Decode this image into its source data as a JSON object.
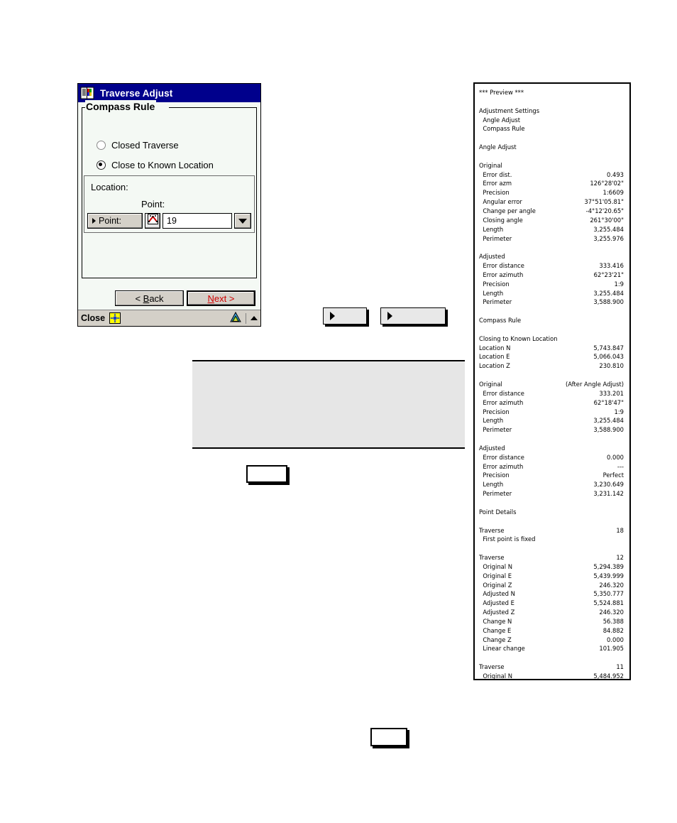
{
  "dialog": {
    "title": "Traverse Adjust",
    "title_icon": "book-icon",
    "group_legend": "Compass Rule",
    "radios": [
      {
        "label": "Closed Traverse",
        "checked": false
      },
      {
        "label": "Close to Known Location",
        "checked": true
      }
    ],
    "location_panel": {
      "location_label": "Location:",
      "point_caption": "Point:",
      "point_button_label": "Point:",
      "map_icon": "point-picker-icon",
      "point_value": "19",
      "dropdown_icon": "chevron-down-icon"
    },
    "buttons": {
      "back": "< Back",
      "back_underline": "B",
      "next": "Next >",
      "next_underline": "N"
    },
    "statusbar": {
      "close_label": "Close",
      "input_panel_icon": "input-panel-icon",
      "alert_icon": "warning-triangle-icon",
      "expand_icon": "chevron-up-icon"
    }
  },
  "arrow_buttons": [
    {
      "name": "arrow-button-1",
      "icon": "triangle-right-icon",
      "label": ""
    },
    {
      "name": "arrow-button-2",
      "icon": "triangle-right-icon",
      "label": ""
    }
  ],
  "gray_panel": {
    "content": ""
  },
  "empty_boxes": [
    {
      "name": "empty-box-1",
      "content": ""
    },
    {
      "name": "empty-box-2",
      "content": ""
    }
  ],
  "preview": {
    "header": "*** Preview ***",
    "lines": [
      {
        "label": "*** Preview ***",
        "value": ""
      },
      {
        "blank": true
      },
      {
        "label": "Adjustment Settings",
        "value": ""
      },
      {
        "label": "  Angle Adjust",
        "value": ""
      },
      {
        "label": "  Compass Rule",
        "value": ""
      },
      {
        "blank": true
      },
      {
        "label": "Angle Adjust",
        "value": ""
      },
      {
        "blank": true
      },
      {
        "label": "Original",
        "value": ""
      },
      {
        "label": "  Error dist.",
        "value": "0.493"
      },
      {
        "label": "  Error azm",
        "value": "126°28'02\""
      },
      {
        "label": "  Precision",
        "value": "1:6609"
      },
      {
        "label": "  Angular error",
        "value": "37°51'05.81\""
      },
      {
        "label": "  Change per angle",
        "value": "-4°12'20.65\""
      },
      {
        "label": "  Closing angle",
        "value": "261°30'00\""
      },
      {
        "label": "  Length",
        "value": "3,255.484"
      },
      {
        "label": "  Perimeter",
        "value": "3,255.976"
      },
      {
        "blank": true
      },
      {
        "label": "Adjusted",
        "value": ""
      },
      {
        "label": "  Error distance",
        "value": "333.416"
      },
      {
        "label": "  Error azimuth",
        "value": "62°23'21\""
      },
      {
        "label": "  Precision",
        "value": "1:9"
      },
      {
        "label": "  Length",
        "value": "3,255.484"
      },
      {
        "label": "  Perimeter",
        "value": "3,588.900"
      },
      {
        "blank": true
      },
      {
        "label": "Compass Rule",
        "value": ""
      },
      {
        "blank": true
      },
      {
        "label": "Closing to Known Location",
        "value": ""
      },
      {
        "label": "Location N",
        "value": "5,743.847"
      },
      {
        "label": "Location E",
        "value": "5,066.043"
      },
      {
        "label": "Location Z",
        "value": "230.810"
      },
      {
        "blank": true
      },
      {
        "label": "Original",
        "value": "(After Angle Adjust)"
      },
      {
        "label": "  Error distance",
        "value": "333.201"
      },
      {
        "label": "  Error azimuth",
        "value": "62°18'47\""
      },
      {
        "label": "  Precision",
        "value": "1:9"
      },
      {
        "label": "  Length",
        "value": "3,255.484"
      },
      {
        "label": "  Perimeter",
        "value": "3,588.900"
      },
      {
        "blank": true
      },
      {
        "label": "Adjusted",
        "value": ""
      },
      {
        "label": "  Error distance",
        "value": "0.000"
      },
      {
        "label": "  Error azimuth",
        "value": "---"
      },
      {
        "label": "  Precision",
        "value": "Perfect"
      },
      {
        "label": "  Length",
        "value": "3,230.649"
      },
      {
        "label": "  Perimeter",
        "value": "3,231.142"
      },
      {
        "blank": true
      },
      {
        "label": "Point Details",
        "value": ""
      },
      {
        "blank": true
      },
      {
        "label": "Traverse",
        "value": "18"
      },
      {
        "label": "  First point is fixed",
        "value": ""
      },
      {
        "blank": true
      },
      {
        "label": "Traverse",
        "value": "12"
      },
      {
        "label": "  Original N",
        "value": "5,294.389"
      },
      {
        "label": "  Original E",
        "value": "5,439.999"
      },
      {
        "label": "  Original Z",
        "value": "246.320"
      },
      {
        "label": "  Adjusted N",
        "value": "5,350.777"
      },
      {
        "label": "  Adjusted E",
        "value": "5,524.881"
      },
      {
        "label": "  Adjusted Z",
        "value": "246.320"
      },
      {
        "label": "  Change N",
        "value": "56.388"
      },
      {
        "label": "  Change E",
        "value": "84.882"
      },
      {
        "label": "  Change Z",
        "value": "0.000"
      },
      {
        "label": "  Linear change",
        "value": "101.905"
      },
      {
        "blank": true
      },
      {
        "label": "Traverse",
        "value": "11"
      },
      {
        "label": "  Original N",
        "value": "5,484.952"
      }
    ]
  }
}
